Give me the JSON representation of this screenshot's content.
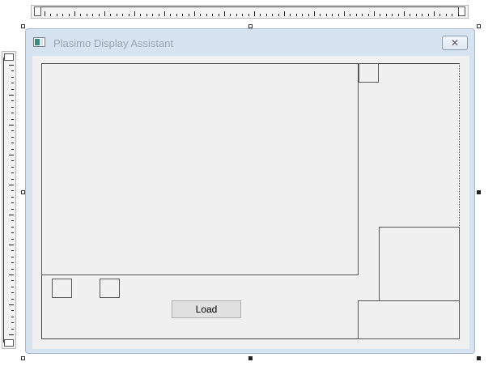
{
  "window": {
    "title": "Plasimo Display Assistant",
    "close_icon_glyph": "✕"
  },
  "controls": {
    "load_label": "Load"
  },
  "colors": {
    "frame": "#d6e3f1",
    "client": "#f0f0f0",
    "title_text": "#9aa5b3",
    "selection_dots": "#3a3aa5"
  },
  "icons": [
    "app-icon",
    "close-icon"
  ]
}
